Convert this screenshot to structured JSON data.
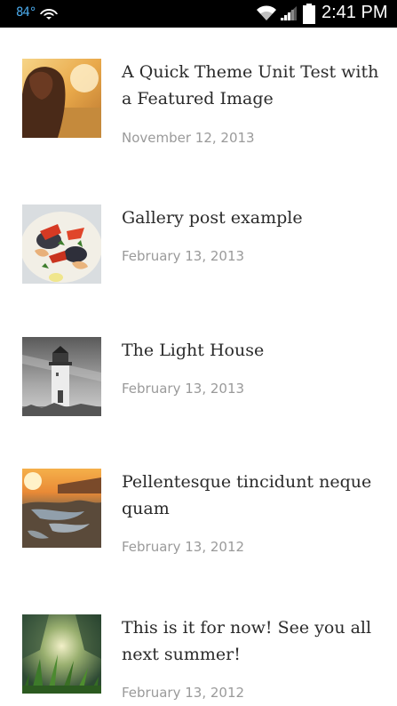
{
  "status_bar": {
    "temperature": "84°",
    "time": "2:41 PM",
    "icons": [
      "screen-cast-icon",
      "wifi-icon",
      "signal-icon",
      "battery-icon"
    ]
  },
  "posts": [
    {
      "title": "A Quick Theme Unit Test with a Featured Image",
      "date": "November 12, 2013",
      "thumbnail": "woman-in-field-sunset"
    },
    {
      "title": "Gallery post example",
      "date": "February 13, 2013",
      "thumbnail": "seafood-dish"
    },
    {
      "title": "The Light House",
      "date": "February 13, 2013",
      "thumbnail": "lighthouse-bw"
    },
    {
      "title": "Pellentesque tincidunt neque quam",
      "date": "February 13, 2012",
      "thumbnail": "sunset-wetland"
    },
    {
      "title": "This is it for now! See you all next summer!",
      "date": "February 13, 2012",
      "thumbnail": "grass-closeup"
    }
  ],
  "colors": {
    "status_bar_bg": "#000000",
    "temperature": "#4aa8e8",
    "title_text": "#2b2b2b",
    "date_text": "#9a9a9a",
    "background": "#ffffff"
  }
}
